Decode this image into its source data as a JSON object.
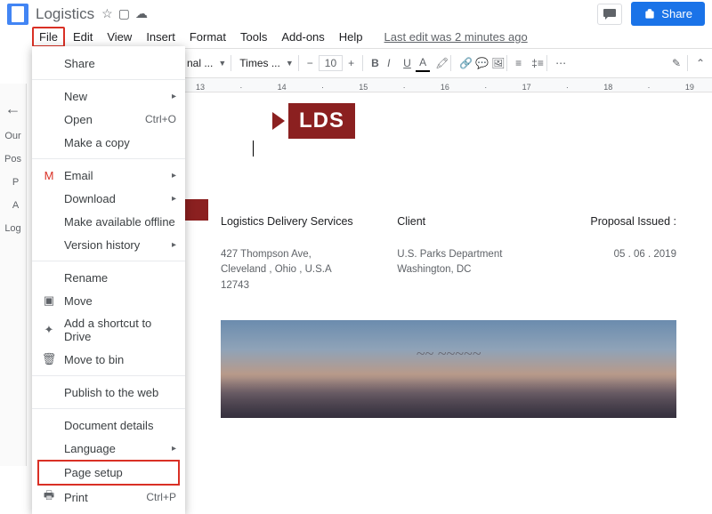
{
  "header": {
    "title": "Logistics",
    "comment_icon": "💬",
    "share_label": "Share"
  },
  "menubar": {
    "items": [
      "File",
      "Edit",
      "View",
      "Insert",
      "Format",
      "Tools",
      "Add-ons",
      "Help"
    ],
    "last_edit": "Last edit was 2 minutes ago"
  },
  "toolbar": {
    "style": "nal ...",
    "font": "Times ...",
    "size": "10",
    "bold": "B",
    "italic": "I",
    "underline": "U",
    "pencil": "✎"
  },
  "ruler": [
    "13",
    "",
    "14",
    "",
    "15",
    "",
    "16",
    "",
    "17",
    "",
    "18",
    "",
    "19"
  ],
  "sidebar": {
    "items": [
      "Our",
      "Pos",
      "P",
      "A",
      "Log"
    ]
  },
  "file_menu": {
    "share": "Share",
    "new": "New",
    "open": "Open",
    "open_shortcut": "Ctrl+O",
    "make_copy": "Make a copy",
    "email": "Email",
    "download": "Download",
    "offline": "Make available offline",
    "version": "Version history",
    "rename": "Rename",
    "move": "Move",
    "shortcut": "Add a shortcut to Drive",
    "move_bin": "Move to bin",
    "publish": "Publish to the web",
    "details": "Document details",
    "language": "Language",
    "page_setup": "Page setup",
    "print": "Print",
    "print_shortcut": "Ctrl+P"
  },
  "doc": {
    "lds": "LDS",
    "col1_head": "Logistics Delivery Services",
    "col2_head": "Client",
    "col3_head": "Proposal Issued :",
    "col1_body1": "427 Thompson Ave,",
    "col1_body2": "Cleveland , Ohio , U.S.A",
    "col1_body3": "12743",
    "col2_body1": "U.S. Parks Department",
    "col2_body2": "Washington, DC",
    "col3_body": "05 . 06 . 2019"
  }
}
